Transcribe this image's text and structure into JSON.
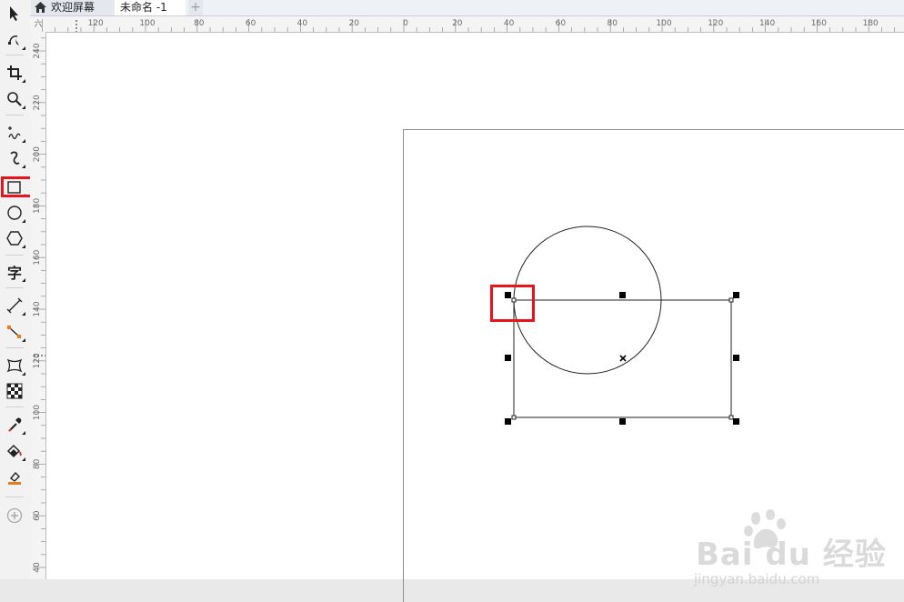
{
  "tabs": {
    "welcome": "欢迎屏幕",
    "document": "未命名 -1",
    "add": "+"
  },
  "toolbox": {
    "tools": [
      {
        "icon": "pick-tool-icon"
      },
      {
        "icon": "shape-tool-icon"
      },
      {
        "icon": "crop-tool-icon"
      },
      {
        "icon": "zoom-tool-icon"
      },
      {
        "icon": "freehand-tool-icon"
      },
      {
        "icon": "artistic-media-tool-icon"
      },
      {
        "icon": "rectangle-tool-icon",
        "active": true
      },
      {
        "icon": "ellipse-tool-icon"
      },
      {
        "icon": "polygon-tool-icon"
      },
      {
        "icon": "text-tool-icon",
        "glyph": "字"
      },
      {
        "icon": "dimension-tool-icon"
      },
      {
        "icon": "connector-tool-icon"
      },
      {
        "icon": "envelope-tool-icon"
      },
      {
        "icon": "transparency-tool-icon"
      },
      {
        "icon": "eyedropper-tool-icon"
      },
      {
        "icon": "interactive-fill-tool-icon"
      },
      {
        "icon": "smart-fill-tool-icon"
      },
      {
        "icon": "add-tool-icon"
      }
    ]
  },
  "rulers": {
    "top_corner": "六",
    "top_labels": [
      "120",
      "100",
      "80",
      "60",
      "40",
      "20",
      "0",
      "20",
      "40",
      "60",
      "80",
      "100",
      "120",
      "140",
      "160",
      "180"
    ],
    "left_labels": [
      "240",
      "220",
      "200",
      "180",
      "160",
      "140",
      "120",
      "100",
      "80",
      "60",
      "40"
    ]
  },
  "watermark": {
    "brand": "Bai du 经验",
    "url": "jingyan.baidu.com"
  },
  "colors": {
    "highlight": "#e8141b",
    "canvas": "#ffffff",
    "workspace": "#e9e9e9"
  }
}
